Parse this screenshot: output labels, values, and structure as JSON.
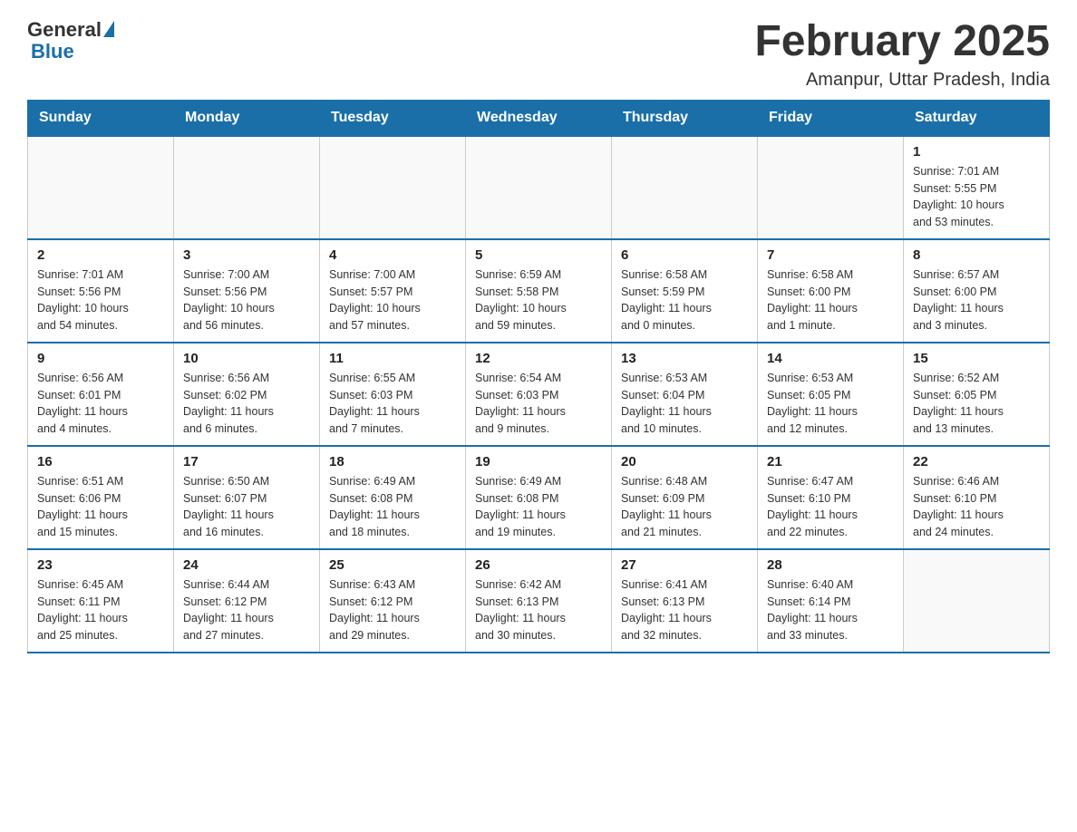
{
  "header": {
    "logo_general": "General",
    "logo_blue": "Blue",
    "month_title": "February 2025",
    "location": "Amanpur, Uttar Pradesh, India"
  },
  "days_of_week": [
    "Sunday",
    "Monday",
    "Tuesday",
    "Wednesday",
    "Thursday",
    "Friday",
    "Saturday"
  ],
  "weeks": [
    [
      {
        "day": "",
        "info": ""
      },
      {
        "day": "",
        "info": ""
      },
      {
        "day": "",
        "info": ""
      },
      {
        "day": "",
        "info": ""
      },
      {
        "day": "",
        "info": ""
      },
      {
        "day": "",
        "info": ""
      },
      {
        "day": "1",
        "info": "Sunrise: 7:01 AM\nSunset: 5:55 PM\nDaylight: 10 hours\nand 53 minutes."
      }
    ],
    [
      {
        "day": "2",
        "info": "Sunrise: 7:01 AM\nSunset: 5:56 PM\nDaylight: 10 hours\nand 54 minutes."
      },
      {
        "day": "3",
        "info": "Sunrise: 7:00 AM\nSunset: 5:56 PM\nDaylight: 10 hours\nand 56 minutes."
      },
      {
        "day": "4",
        "info": "Sunrise: 7:00 AM\nSunset: 5:57 PM\nDaylight: 10 hours\nand 57 minutes."
      },
      {
        "day": "5",
        "info": "Sunrise: 6:59 AM\nSunset: 5:58 PM\nDaylight: 10 hours\nand 59 minutes."
      },
      {
        "day": "6",
        "info": "Sunrise: 6:58 AM\nSunset: 5:59 PM\nDaylight: 11 hours\nand 0 minutes."
      },
      {
        "day": "7",
        "info": "Sunrise: 6:58 AM\nSunset: 6:00 PM\nDaylight: 11 hours\nand 1 minute."
      },
      {
        "day": "8",
        "info": "Sunrise: 6:57 AM\nSunset: 6:00 PM\nDaylight: 11 hours\nand 3 minutes."
      }
    ],
    [
      {
        "day": "9",
        "info": "Sunrise: 6:56 AM\nSunset: 6:01 PM\nDaylight: 11 hours\nand 4 minutes."
      },
      {
        "day": "10",
        "info": "Sunrise: 6:56 AM\nSunset: 6:02 PM\nDaylight: 11 hours\nand 6 minutes."
      },
      {
        "day": "11",
        "info": "Sunrise: 6:55 AM\nSunset: 6:03 PM\nDaylight: 11 hours\nand 7 minutes."
      },
      {
        "day": "12",
        "info": "Sunrise: 6:54 AM\nSunset: 6:03 PM\nDaylight: 11 hours\nand 9 minutes."
      },
      {
        "day": "13",
        "info": "Sunrise: 6:53 AM\nSunset: 6:04 PM\nDaylight: 11 hours\nand 10 minutes."
      },
      {
        "day": "14",
        "info": "Sunrise: 6:53 AM\nSunset: 6:05 PM\nDaylight: 11 hours\nand 12 minutes."
      },
      {
        "day": "15",
        "info": "Sunrise: 6:52 AM\nSunset: 6:05 PM\nDaylight: 11 hours\nand 13 minutes."
      }
    ],
    [
      {
        "day": "16",
        "info": "Sunrise: 6:51 AM\nSunset: 6:06 PM\nDaylight: 11 hours\nand 15 minutes."
      },
      {
        "day": "17",
        "info": "Sunrise: 6:50 AM\nSunset: 6:07 PM\nDaylight: 11 hours\nand 16 minutes."
      },
      {
        "day": "18",
        "info": "Sunrise: 6:49 AM\nSunset: 6:08 PM\nDaylight: 11 hours\nand 18 minutes."
      },
      {
        "day": "19",
        "info": "Sunrise: 6:49 AM\nSunset: 6:08 PM\nDaylight: 11 hours\nand 19 minutes."
      },
      {
        "day": "20",
        "info": "Sunrise: 6:48 AM\nSunset: 6:09 PM\nDaylight: 11 hours\nand 21 minutes."
      },
      {
        "day": "21",
        "info": "Sunrise: 6:47 AM\nSunset: 6:10 PM\nDaylight: 11 hours\nand 22 minutes."
      },
      {
        "day": "22",
        "info": "Sunrise: 6:46 AM\nSunset: 6:10 PM\nDaylight: 11 hours\nand 24 minutes."
      }
    ],
    [
      {
        "day": "23",
        "info": "Sunrise: 6:45 AM\nSunset: 6:11 PM\nDaylight: 11 hours\nand 25 minutes."
      },
      {
        "day": "24",
        "info": "Sunrise: 6:44 AM\nSunset: 6:12 PM\nDaylight: 11 hours\nand 27 minutes."
      },
      {
        "day": "25",
        "info": "Sunrise: 6:43 AM\nSunset: 6:12 PM\nDaylight: 11 hours\nand 29 minutes."
      },
      {
        "day": "26",
        "info": "Sunrise: 6:42 AM\nSunset: 6:13 PM\nDaylight: 11 hours\nand 30 minutes."
      },
      {
        "day": "27",
        "info": "Sunrise: 6:41 AM\nSunset: 6:13 PM\nDaylight: 11 hours\nand 32 minutes."
      },
      {
        "day": "28",
        "info": "Sunrise: 6:40 AM\nSunset: 6:14 PM\nDaylight: 11 hours\nand 33 minutes."
      },
      {
        "day": "",
        "info": ""
      }
    ]
  ],
  "colors": {
    "header_bg": "#1a6fa8",
    "header_text": "#ffffff",
    "border": "#1a6fa8",
    "cell_border": "#cccccc"
  }
}
